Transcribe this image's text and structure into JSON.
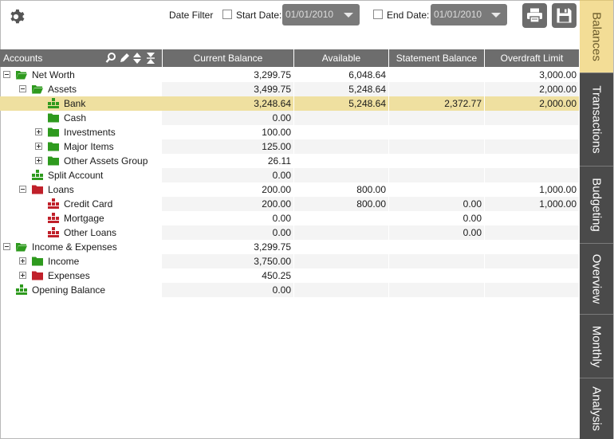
{
  "toolbar": {
    "date_filter_label": "Date Filter",
    "start_date_label": "Start Date:",
    "start_date_value": "01/01/2010",
    "end_date_label": "End Date:",
    "end_date_value": "01/01/2010",
    "print_icon": "printer-icon",
    "save_icon": "floppy-disk-icon"
  },
  "columns": {
    "accounts": "Accounts",
    "current_balance": "Current Balance",
    "available": "Available",
    "statement_balance": "Statement Balance",
    "overdraft_limit": "Overdraft Limit"
  },
  "rows": [
    {
      "label": "Net Worth",
      "current": "3,299.75",
      "available": "6,048.64",
      "statement": "",
      "overdraft": "3,000.00"
    },
    {
      "label": "Assets",
      "current": "3,499.75",
      "available": "5,248.64",
      "statement": "",
      "overdraft": "2,000.00"
    },
    {
      "label": "Bank",
      "current": "3,248.64",
      "available": "5,248.64",
      "statement": "2,372.77",
      "overdraft": "2,000.00"
    },
    {
      "label": "Cash",
      "current": "0.00",
      "available": "",
      "statement": "",
      "overdraft": ""
    },
    {
      "label": "Investments",
      "current": "100.00",
      "available": "",
      "statement": "",
      "overdraft": ""
    },
    {
      "label": "Major Items",
      "current": "125.00",
      "available": "",
      "statement": "",
      "overdraft": ""
    },
    {
      "label": "Other Assets Group",
      "current": "26.11",
      "available": "",
      "statement": "",
      "overdraft": ""
    },
    {
      "label": "Split Account",
      "current": "0.00",
      "available": "",
      "statement": "",
      "overdraft": ""
    },
    {
      "label": "Loans",
      "current": "200.00",
      "available": "800.00",
      "statement": "",
      "overdraft": "1,000.00"
    },
    {
      "label": "Credit Card",
      "current": "200.00",
      "available": "800.00",
      "statement": "0.00",
      "overdraft": "1,000.00"
    },
    {
      "label": "Mortgage",
      "current": "0.00",
      "available": "",
      "statement": "0.00",
      "overdraft": ""
    },
    {
      "label": "Other Loans",
      "current": "0.00",
      "available": "",
      "statement": "0.00",
      "overdraft": ""
    },
    {
      "label": "Income & Expenses",
      "current": "3,299.75",
      "available": "",
      "statement": "",
      "overdraft": ""
    },
    {
      "label": "Income",
      "current": "3,750.00",
      "available": "",
      "statement": "",
      "overdraft": ""
    },
    {
      "label": "Expenses",
      "current": "450.25",
      "available": "",
      "statement": "",
      "overdraft": ""
    },
    {
      "label": "Opening Balance",
      "current": "0.00",
      "available": "",
      "statement": "",
      "overdraft": ""
    }
  ],
  "tabs": [
    "Balances",
    "Transactions",
    "Budgeting",
    "Overview",
    "Monthly",
    "Analysis"
  ],
  "colors": {
    "header_bg": "#6d6d6d",
    "selected_row": "#efe0a0",
    "green_folder": "#2e9a1e",
    "red_folder": "#c0202a",
    "tab_active": "#f3dd96",
    "tab_inactive": "#4a4a4a"
  }
}
